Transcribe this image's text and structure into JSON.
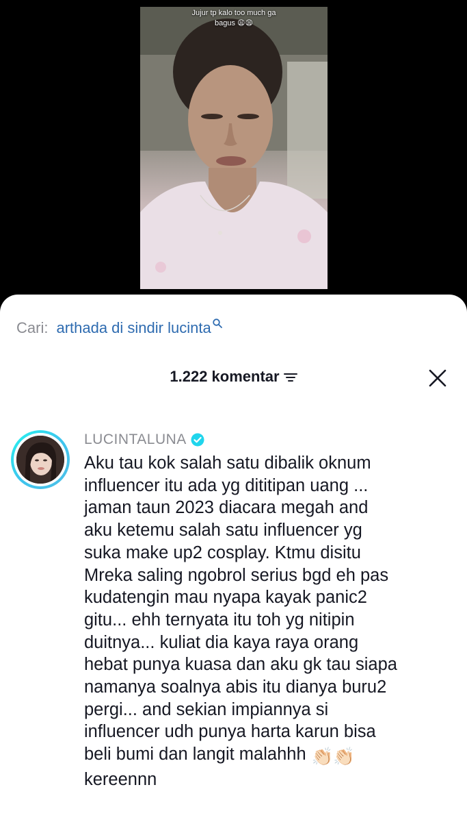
{
  "video": {
    "caption_line1": "Jujur tp kalo too much ga",
    "caption_line2": "bagus 😩😩"
  },
  "search": {
    "prefix": "Cari:",
    "query": "arthada di sindir lucinta",
    "icon": "search-icon"
  },
  "comments_header": {
    "count_label": "1.222 komentar",
    "sort_icon": "sort-icon",
    "close_icon": "close-icon"
  },
  "comment": {
    "author": "LUCINTALUNA",
    "verified": true,
    "lines": [
      "Aku tau kok salah satu dibalik oknum",
      "influencer itu ada yg dititipan uang ...",
      "jaman taun 2023 diacara megah and",
      "aku ketemu salah satu influencer yg",
      "suka make up2 cosplay. Ktmu disitu",
      "Mreka saling ngobrol serius bgd eh pas",
      "kudatengin mau nyapa kayak panic2",
      "gitu... ehh ternyata itu toh yg nitipin",
      "duitnya... kuliat dia kaya raya orang",
      "hebat punya kuasa dan aku gk tau siapa",
      "namanya soalnya abis itu dianya buru2",
      "pergi... and sekian impiannya si",
      "influencer udh punya harta karun bisa",
      "beli bumi dan langit malahhh",
      "kereennn"
    ],
    "emoji_after_line_14": "👏🏻👏🏻"
  },
  "colors": {
    "query_blue": "#2e6bb0",
    "muted_gray": "#8a8b91",
    "text_dark": "#161823",
    "verified_blue": "#20d5ec"
  }
}
